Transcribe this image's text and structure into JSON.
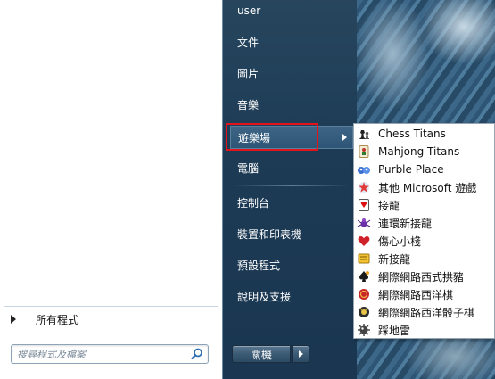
{
  "start_menu": {
    "left_pane": {
      "all_programs_label": "所有程式",
      "search_placeholder": "搜尋程式及檔案"
    },
    "right_pane": {
      "items": [
        {
          "label": "user"
        },
        {
          "label": "文件"
        },
        {
          "label": "圖片"
        },
        {
          "label": "音樂"
        },
        {
          "label": "遊樂場"
        },
        {
          "label": "電腦"
        },
        {
          "label": "控制台"
        },
        {
          "label": "裝置和印表機"
        },
        {
          "label": "預設程式"
        },
        {
          "label": "說明及支援"
        }
      ],
      "shutdown_label": "關機"
    }
  },
  "games_submenu": {
    "items": [
      {
        "label": "Chess Titans",
        "icon": "chess-icon"
      },
      {
        "label": "Mahjong Titans",
        "icon": "mahjong-icon"
      },
      {
        "label": "Purble Place",
        "icon": "purble-icon"
      },
      {
        "label": "其他 Microsoft 遊戲",
        "icon": "more-games-icon"
      },
      {
        "label": "接龍",
        "icon": "solitaire-icon"
      },
      {
        "label": "連環新接龍",
        "icon": "spider-icon"
      },
      {
        "label": "傷心小棧",
        "icon": "hearts-icon"
      },
      {
        "label": "新接龍",
        "icon": "freecell-icon"
      },
      {
        "label": "網際網路西式拱豬",
        "icon": "spades-icon"
      },
      {
        "label": "網際網路西洋棋",
        "icon": "checkers-icon"
      },
      {
        "label": "網際網路西洋骰子棋",
        "icon": "backgammon-icon"
      },
      {
        "label": "踩地雷",
        "icon": "minesweeper-icon"
      }
    ]
  },
  "colors": {
    "highlight_box": "#e0141a",
    "menu_background": "#1d3b55",
    "left_pane": "#ffffff"
  }
}
